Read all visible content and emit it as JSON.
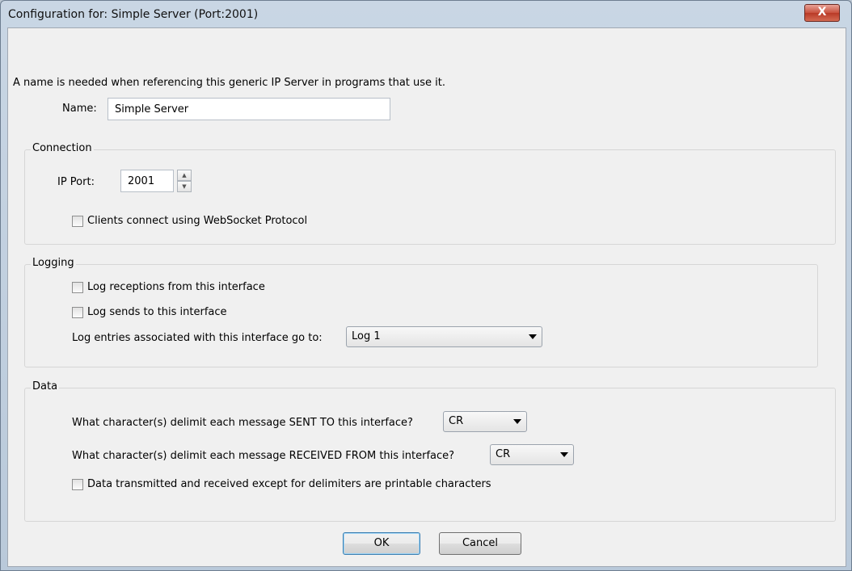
{
  "window": {
    "title": "Configuration for: Simple Server (Port:2001)",
    "close_glyph": "X"
  },
  "intro": {
    "text": "A name is needed when referencing this generic IP Server in programs that use it."
  },
  "name_field": {
    "label": "Name:",
    "value": "Simple Server"
  },
  "connection": {
    "group_label": "Connection",
    "port_label": "IP Port:",
    "port_value": "2001",
    "spin_up": "▲",
    "spin_down": "▼",
    "websocket_label": "Clients connect using WebSocket Protocol"
  },
  "logging": {
    "group_label": "Logging",
    "receptions_label": "Log receptions from this interface",
    "sends_label": "Log sends to this interface",
    "destination_label": "Log entries associated with this interface go to:",
    "destination_value": "Log 1"
  },
  "data": {
    "group_label": "Data",
    "sent_label": "What character(s) delimit each message SENT TO this interface?",
    "sent_value": "CR",
    "received_label": "What character(s) delimit each message RECEIVED FROM this interface?",
    "received_value": "CR",
    "printable_label": "Data transmitted and received except for delimiters are printable characters"
  },
  "buttons": {
    "ok": "OK",
    "cancel": "Cancel"
  }
}
